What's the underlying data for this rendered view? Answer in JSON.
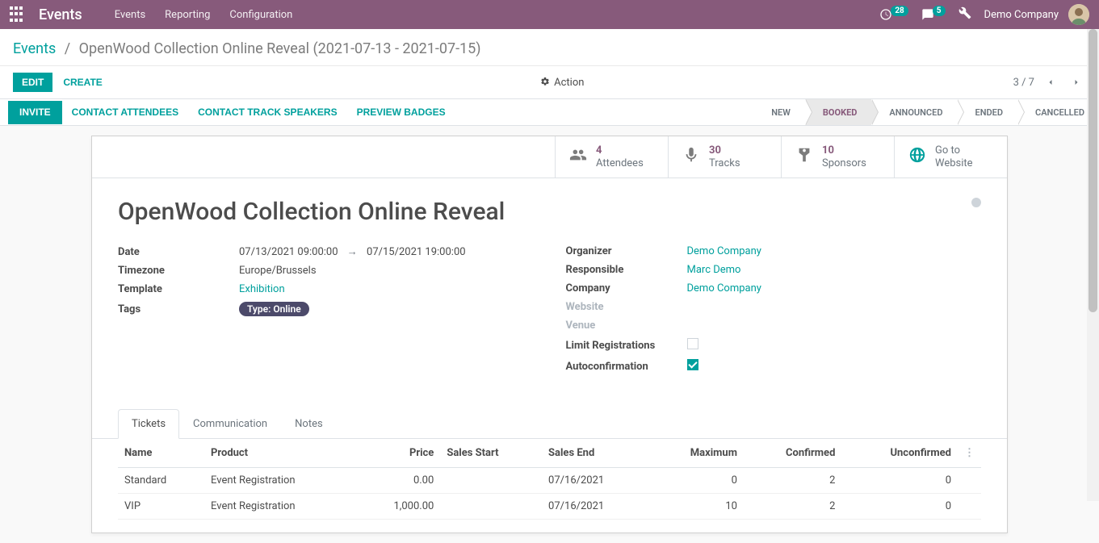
{
  "topbar": {
    "brand": "Events",
    "nav": [
      "Events",
      "Reporting",
      "Configuration"
    ],
    "clock_badge": "28",
    "chat_badge": "5",
    "company": "Demo Company"
  },
  "breadcrumb": {
    "parent": "Events",
    "current": "OpenWood Collection Online Reveal (2021-07-13 - 2021-07-15)"
  },
  "controls": {
    "edit": "EDIT",
    "create": "CREATE",
    "action": "Action",
    "pager": "3 / 7"
  },
  "statusbar": {
    "invite": "INVITE",
    "contact_attendees": "CONTACT ATTENDEES",
    "contact_speakers": "CONTACT TRACK SPEAKERS",
    "preview_badges": "PREVIEW BADGES",
    "stages": [
      "NEW",
      "BOOKED",
      "ANNOUNCED",
      "ENDED",
      "CANCELLED"
    ],
    "active": "BOOKED"
  },
  "stats": {
    "attendees": {
      "value": "4",
      "label": "Attendees"
    },
    "tracks": {
      "value": "30",
      "label": "Tracks"
    },
    "sponsors": {
      "value": "10",
      "label": "Sponsors"
    },
    "website": {
      "top": "Go to",
      "bottom": "Website"
    }
  },
  "title": "OpenWood Collection Online Reveal",
  "fields": {
    "date_label": "Date",
    "date_start": "07/13/2021 09:00:00",
    "date_end": "07/15/2021 19:00:00",
    "timezone_label": "Timezone",
    "timezone": "Europe/Brussels",
    "template_label": "Template",
    "template": "Exhibition",
    "tags_label": "Tags",
    "tag": "Type: Online",
    "organizer_label": "Organizer",
    "organizer": "Demo Company",
    "responsible_label": "Responsible",
    "responsible": "Marc Demo",
    "company_label": "Company",
    "company": "Demo Company",
    "website_label": "Website",
    "venue_label": "Venue",
    "limit_label": "Limit Registrations",
    "autoconf_label": "Autoconfirmation"
  },
  "tabs": [
    "Tickets",
    "Communication",
    "Notes"
  ],
  "tickets": {
    "headers": {
      "name": "Name",
      "product": "Product",
      "price": "Price",
      "sales_start": "Sales Start",
      "sales_end": "Sales End",
      "maximum": "Maximum",
      "confirmed": "Confirmed",
      "unconfirmed": "Unconfirmed"
    },
    "rows": [
      {
        "name": "Standard",
        "product": "Event Registration",
        "price": "0.00",
        "sales_start": "",
        "sales_end": "07/16/2021",
        "maximum": "0",
        "confirmed": "2",
        "unconfirmed": "0"
      },
      {
        "name": "VIP",
        "product": "Event Registration",
        "price": "1,000.00",
        "sales_start": "",
        "sales_end": "07/16/2021",
        "maximum": "10",
        "confirmed": "2",
        "unconfirmed": "0"
      }
    ]
  }
}
